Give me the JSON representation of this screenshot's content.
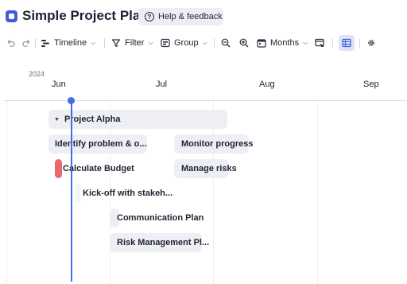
{
  "header": {
    "title": "Simple Project Plan",
    "help_label": "Help & feedback"
  },
  "toolbar": {
    "timeline_label": "Timeline",
    "filter_label": "Filter",
    "group_label": "Group",
    "scale_label": "Months"
  },
  "timeline": {
    "year": "2024",
    "months": [
      "Jun",
      "Jul",
      "Aug",
      "Sep"
    ]
  },
  "tasks": [
    {
      "name": "Project Alpha",
      "type": "group"
    },
    {
      "name": "Identify problem & o...",
      "type": "task"
    },
    {
      "name": "Monitor progress",
      "type": "task"
    },
    {
      "name": "Calculate Budget",
      "type": "task",
      "status_color": "#e86a6a"
    },
    {
      "name": "Manage risks",
      "type": "task"
    },
    {
      "name": "Kick-off with stakeh...",
      "type": "task"
    },
    {
      "name": "Communication Plan",
      "type": "task"
    },
    {
      "name": "Risk Management Pl...",
      "type": "task"
    }
  ],
  "colors": {
    "accent": "#3d5ed9",
    "today": "#3d6fe6",
    "bar": "#eeeff4",
    "alert": "#e86a6a"
  },
  "icons": [
    "app-logo-icon",
    "help-icon",
    "undo-icon",
    "redo-icon",
    "timeline-icon",
    "filter-icon",
    "group-icon",
    "zoom-out-icon",
    "zoom-in-icon",
    "calendar-icon",
    "fit-to-screen-icon",
    "table-view-icon",
    "settings-gear-icon"
  ]
}
